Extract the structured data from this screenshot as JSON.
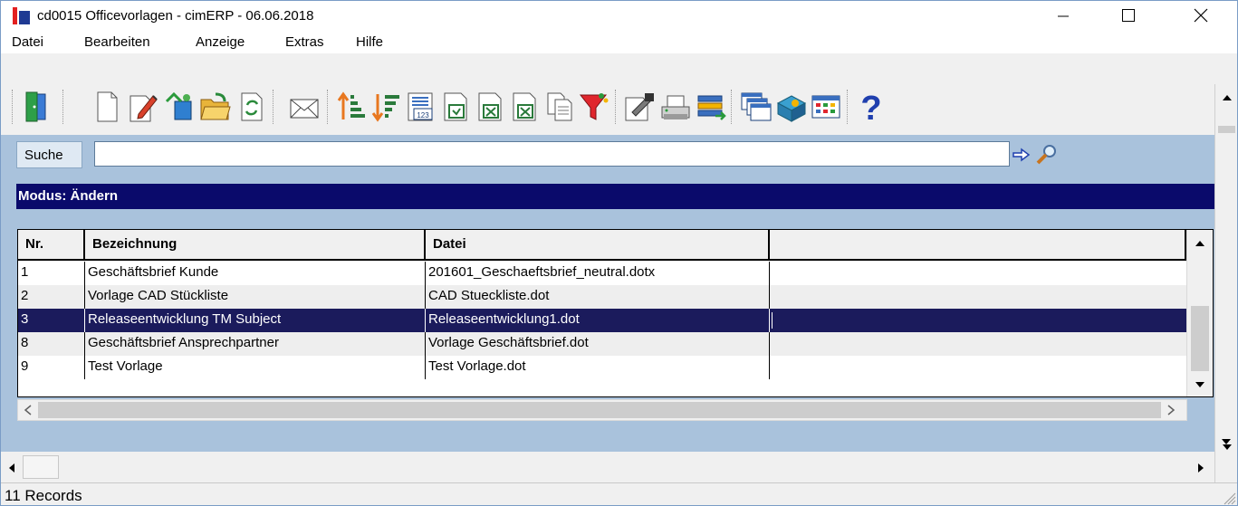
{
  "window": {
    "title": "cd0015 Officevorlagen - cimERP - 06.06.2018"
  },
  "menu": [
    "Datei",
    "Bearbeiten",
    "Anzeige",
    "Extras",
    "Hilfe"
  ],
  "search": {
    "label": "Suche",
    "value": ""
  },
  "mode": {
    "text": "Modus: Ändern"
  },
  "grid": {
    "headers": [
      "Nr.",
      "Bezeichnung",
      "Datei",
      ""
    ],
    "rows": [
      {
        "nr": "1",
        "bezeichnung": "Geschäftsbrief Kunde",
        "datei": "201601_Geschaeftsbrief_neutral.dotx"
      },
      {
        "nr": "2",
        "bezeichnung": "Vorlage CAD Stückliste",
        "datei": "CAD Stueckliste.dot"
      },
      {
        "nr": "3",
        "bezeichnung": "Releaseentwicklung TM Subject",
        "datei": "Releaseentwicklung1.dot"
      },
      {
        "nr": "8",
        "bezeichnung": "Geschäftsbrief Ansprechpartner",
        "datei": "Vorlage Geschäftsbrief.dot"
      },
      {
        "nr": "9",
        "bezeichnung": "Test Vorlage",
        "datei": "Test Vorlage.dot"
      }
    ],
    "selected_row": 2
  },
  "status": {
    "text": "11 Records"
  },
  "colors": {
    "mode_bar": "#0a0a6b",
    "selected_row": "#1b1b5c",
    "panel_bg": "#a9c2dc"
  },
  "toolbar_icons": [
    "exit-door-icon",
    "new-document-icon",
    "edit-pencil-icon",
    "copy-record-icon",
    "open-folder-icon",
    "refresh-icon",
    "email-envelope-icon",
    "sort-ascending-icon",
    "sort-descending-icon",
    "numbered-list-icon",
    "export-document-icon",
    "excel-export-icon",
    "copy-pages-icon",
    "filter-funnel-icon",
    "properties-icon",
    "print-icon",
    "transfer-icon",
    "windows-icon",
    "install-package-icon",
    "grid-view-icon",
    "help-question-icon"
  ]
}
